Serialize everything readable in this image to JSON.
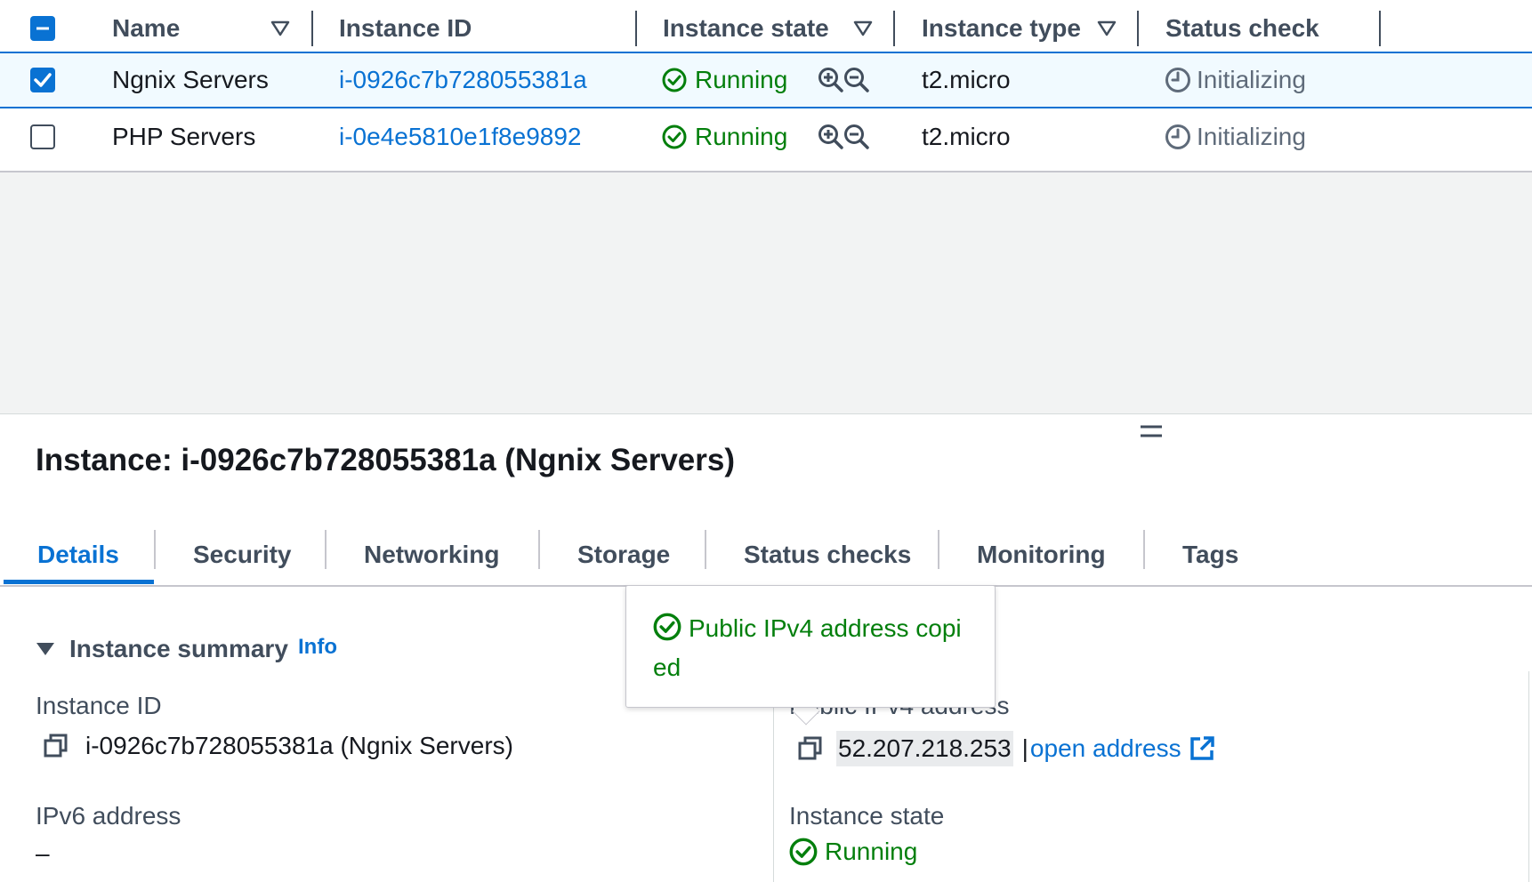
{
  "table": {
    "columns": [
      {
        "label": "Name",
        "sortable": true
      },
      {
        "label": "Instance ID",
        "sortable": false
      },
      {
        "label": "Instance state",
        "sortable": true
      },
      {
        "label": "Instance type",
        "sortable": true
      },
      {
        "label": "Status check",
        "sortable": false
      }
    ],
    "rows": [
      {
        "selected": true,
        "name": "Ngnix Servers",
        "instance_id": "i-0926c7b728055381a",
        "state": "Running",
        "type": "t2.micro",
        "status_check": "Initializing"
      },
      {
        "selected": false,
        "name": "PHP Servers",
        "instance_id": "i-0e4e5810e1f8e9892",
        "state": "Running",
        "type": "t2.micro",
        "status_check": "Initializing"
      }
    ]
  },
  "panel": {
    "title": "Instance: i-0926c7b728055381a (Ngnix Servers)",
    "tabs": [
      "Details",
      "Security",
      "Networking",
      "Storage",
      "Status checks",
      "Monitoring",
      "Tags"
    ],
    "active_tab": "Details",
    "section_title": "Instance summary",
    "info_label": "Info",
    "instance_id_label": "Instance ID",
    "instance_id_value": "i-0926c7b728055381a (Ngnix Servers)",
    "ipv6_label": "IPv6 address",
    "ipv6_value": "–",
    "public_ipv4_label": "Public IPv4 address",
    "public_ipv4_value": "52.207.218.253",
    "open_address_label": "open address",
    "instance_state_label": "Instance state",
    "instance_state_value": "Running"
  },
  "popover": {
    "message": "Public IPv4 address copied"
  },
  "colors": {
    "accent": "#0972d3",
    "success": "#037f0c",
    "muted": "#5f6b7a"
  }
}
